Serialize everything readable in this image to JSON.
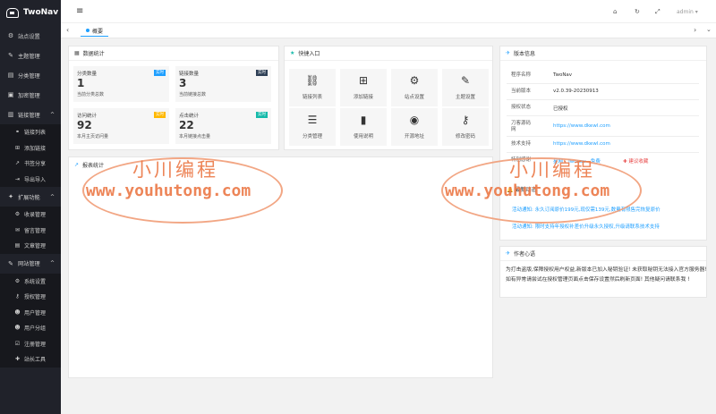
{
  "app": {
    "name": "TwoNav"
  },
  "sidebar": {
    "items": [
      {
        "label": "站点设置",
        "icon": "gear-icon"
      },
      {
        "label": "主题管理",
        "icon": "brush-icon"
      },
      {
        "label": "分类管理",
        "icon": "list-icon"
      },
      {
        "label": "加密管理",
        "icon": "lock-icon"
      },
      {
        "label": "链接管理",
        "icon": "link-group-icon",
        "arrow": "^"
      }
    ],
    "link_sub": [
      {
        "label": "链接列表",
        "icon": "link-icon"
      },
      {
        "label": "添加链接",
        "icon": "plus-icon"
      },
      {
        "label": "书签分享",
        "icon": "share-icon"
      },
      {
        "label": "导出导入",
        "icon": "export-icon"
      }
    ],
    "ext": {
      "label": "扩展功能",
      "icon": "puzzle-icon",
      "arrow": "^"
    },
    "ext_sub": [
      {
        "label": "收录管理",
        "icon": "inbox-icon"
      },
      {
        "label": "留言管理",
        "icon": "message-icon"
      },
      {
        "label": "文章管理",
        "icon": "article-icon"
      }
    ],
    "site": {
      "label": "网站管理",
      "icon": "wrench-icon",
      "arrow": "^"
    },
    "site_sub": [
      {
        "label": "系统设置",
        "icon": "gears-icon"
      },
      {
        "label": "授权管理",
        "icon": "key-icon"
      },
      {
        "label": "用户管理",
        "icon": "user-icon"
      },
      {
        "label": "用户分组",
        "icon": "users-icon"
      },
      {
        "label": "注册管理",
        "icon": "register-icon"
      },
      {
        "label": "站长工具",
        "icon": "tool-icon"
      }
    ]
  },
  "topbar": {
    "menu_icon": "≡",
    "home_icon": "⌂",
    "refresh_icon": "↻",
    "fullscreen_icon": "⤢",
    "user": "admin ▾"
  },
  "tabbar": {
    "left": "‹",
    "right": "›",
    "dropdown": "⌄",
    "tab": "概要"
  },
  "stats": {
    "title": "数据统计",
    "items": [
      {
        "label": "分类数量",
        "value": "1",
        "sub": "当前分类总数",
        "badge": "实时",
        "badge_color": "#1e9fff"
      },
      {
        "label": "链接数量",
        "value": "3",
        "sub": "当前链接总数",
        "badge": "实时",
        "badge_color": "#2f4056"
      },
      {
        "label": "访问统计",
        "value": "92",
        "sub": "本月主页访问量",
        "badge": "实时",
        "badge_color": "#ffb800"
      },
      {
        "label": "点击统计",
        "value": "22",
        "sub": "本月链接点击量",
        "badge": "实时",
        "badge_color": "#16baaa"
      }
    ]
  },
  "quick": {
    "title": "快捷入口",
    "items": [
      {
        "label": "链接列表",
        "icon": "⛓"
      },
      {
        "label": "添加链接",
        "icon": "⊞"
      },
      {
        "label": "站点设置",
        "icon": "⚙"
      },
      {
        "label": "主题设置",
        "icon": "✎"
      },
      {
        "label": "分类管理",
        "icon": "☰"
      },
      {
        "label": "使用说明",
        "icon": "▮"
      },
      {
        "label": "开源地址",
        "icon": "◉"
      },
      {
        "label": "修改密码",
        "icon": "⚷"
      }
    ]
  },
  "report": {
    "title": "报表统计"
  },
  "version": {
    "title": "版本信息",
    "rows": [
      {
        "k": "程序名称",
        "v": "TwoNav"
      },
      {
        "k": "当前版本",
        "v": "v2.0.39-20230913"
      },
      {
        "k": "授权状态",
        "v": "已授权"
      },
      {
        "k": "刀客源码网",
        "v": "https://www.dkewl.com"
      },
      {
        "k": "技术支持",
        "v": "https://www.dkewl.com"
      },
      {
        "k": "特别感谢",
        "v": "星网 · Twonav · 免费"
      }
    ],
    "favorite": "✚ 建议收藏"
  },
  "notices": {
    "title": "最新动态",
    "items": [
      "活动通知: 永久订阅原价199元,现仅需139元,数量有限售完恢复原价",
      "活动通知: 限时支持年授权补差价升级永久授权,升级请联系技术支持"
    ]
  },
  "author": {
    "title": "作者心语",
    "lines": [
      "为打击盗版,保障授权用户权益,新版本已加入秘钥验证! 未获取秘钥无法接入官方服务器!",
      "如有异常请尝试在授权管理页面点击保存设置然后刷新页面! 其他疑问请联系我 !"
    ]
  },
  "watermark": {
    "title": "小川编程",
    "url": "www.youhutong.com"
  }
}
